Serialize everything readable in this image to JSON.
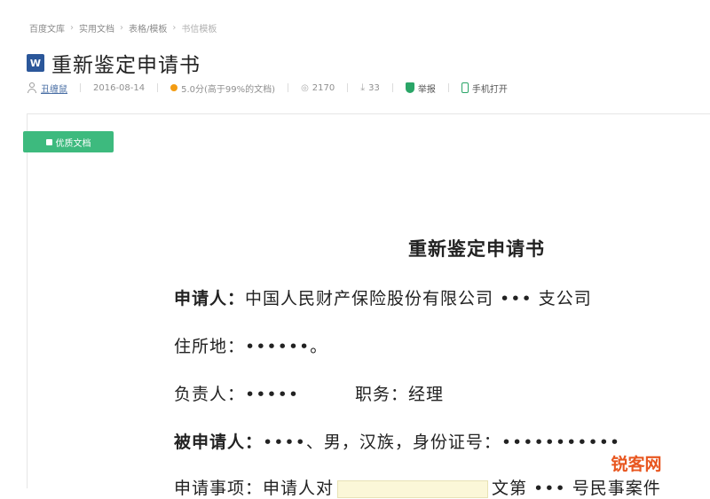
{
  "breadcrumb": {
    "items": [
      "百度文库",
      "实用文档",
      "表格/模板",
      "书信模板"
    ]
  },
  "title": "重新鉴定申请书",
  "file_type_icon": "word-doc-icon",
  "meta": {
    "author": "丑缠鼠",
    "date": "2016-08-14",
    "rating": "5.0分(高于99%的文档)",
    "views": "2170",
    "downloads": "33",
    "report": "举报",
    "mobile": "手机打开"
  },
  "tag": "优质文档",
  "document": {
    "heading": "重新鉴定申请书",
    "applicant_label": "申请人：",
    "applicant_value": "中国人民财产保险股份有限公司 ••• 支公司",
    "address": "住所地：••••••。",
    "leader": "负责人：•••••",
    "duty": "职务：经理",
    "respondent_label": "被申请人：",
    "respondent_value": "••••、男，汉族，身份证号：•••••••••••",
    "matter_start": "申请事项：申请人对",
    "matter_end": "文第 ••• 号民事案件"
  },
  "watermark": "锐客网",
  "colors": {
    "accent_green": "#3dba7e",
    "word_blue": "#2b579a",
    "watermark_orange": "#e8561f"
  }
}
